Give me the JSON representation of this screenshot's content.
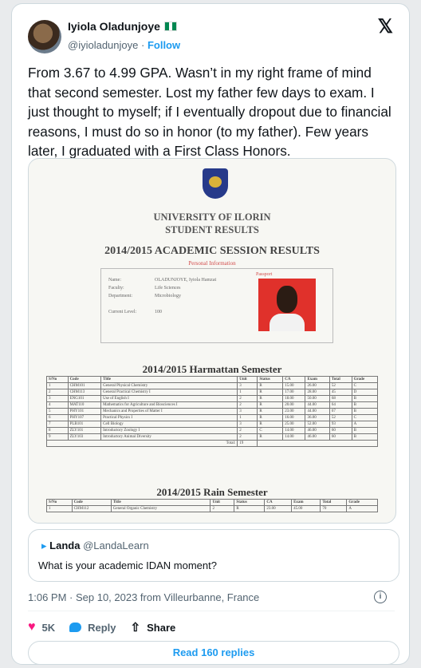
{
  "tweet": {
    "author_name": "Iyiola Oladunjoye",
    "handle": "@iyioladunjoye",
    "separator": "·",
    "follow_label": "Follow",
    "text": "From 3.67 to 4.99 GPA. Wasn’t in my right frame of mind that second semester. Lost my father few days to exam. I just thought to myself; if I eventually dropout due to financial reasons, I must do so in honor (to my father). Few years later, I graduated with a First Class Honors.",
    "flag_colors": [
      "#008751",
      "#ffffff",
      "#008751"
    ],
    "x_logo": "𝕏"
  },
  "media": {
    "university": "UNIVERSITY OF ILORIN",
    "subtitle": "STUDENT RESULTS",
    "session_title": "2014/2015 ACADEMIC SESSION RESULTS",
    "personal_info": "Personal Information",
    "passport": "Passport",
    "fields": [
      "Name:",
      "Faculty:",
      "Department:",
      "Current Level:"
    ],
    "field_values": [
      "OLADUNJOYE, Iyiola Hamzat",
      "Life Sciences",
      "Microbiology",
      "100"
    ],
    "semester1_title": "2014/2015 Harmattan Semester",
    "semester2_title": "2014/2015 Rain Semester",
    "table_headers": [
      "S/No",
      "Code",
      "Title",
      "Unit",
      "Status",
      "CA",
      "Exam",
      "Total",
      "Grade"
    ],
    "rows1": [
      [
        "1",
        "CHM101",
        "General Physical Chemistry",
        "3",
        "R",
        "15.00",
        "26.00",
        "52",
        "C"
      ],
      [
        "2",
        "CHM113",
        "General Practical Chemistry I",
        "1",
        "R",
        "17.00",
        "28.00",
        "45",
        "D"
      ],
      [
        "3",
        "ENG101",
        "Use of English I",
        "2",
        "R",
        "18.00",
        "50.00",
        "68",
        "B"
      ],
      [
        "4",
        "MAT110",
        "Mathematics for Agriculture and Biosciences I",
        "2",
        "R",
        "20.00",
        "44.00",
        "64",
        "B"
      ],
      [
        "5",
        "PHY101",
        "Mechanics and Properties of Matter I",
        "3",
        "R",
        "23.00",
        "44.00",
        "67",
        "B"
      ],
      [
        "6",
        "PHY107",
        "Practical Physics I",
        "1",
        "R",
        "16.00",
        "36.00",
        "52",
        "C"
      ],
      [
        "7",
        "PLB101",
        "Cell Biology",
        "3",
        "R",
        "25.00",
        "52.00",
        "93",
        "A"
      ],
      [
        "8",
        "ZLY101",
        "Introductory Zoology I",
        "2",
        "C",
        "14.00",
        "46.00",
        "60",
        "B"
      ],
      [
        "9",
        "ZLY103",
        "Introductory Animal Diversity",
        "2",
        "R",
        "14.00",
        "46.00",
        "60",
        "B"
      ]
    ],
    "total_label": "Total:",
    "total_units": "19",
    "rows2": [
      [
        "1",
        "CHM112",
        "General Organic Chemistry",
        "2",
        "R",
        "23.00",
        "45.00",
        "70",
        "A"
      ]
    ]
  },
  "quote": {
    "name": "Landa",
    "handle": "@LandaLearn",
    "text": "What is your academic IDAN moment?"
  },
  "meta": {
    "timestamp": "1:06 PM · Sep 10, 2023 from Villeurbanne, France",
    "info_glyph": "i"
  },
  "actions": {
    "likes": "5K",
    "reply_label": "Reply",
    "share_label": "Share",
    "read_replies": "Read 160 replies"
  },
  "colors": {
    "accent": "#1d9bf0",
    "like": "#f91880",
    "text": "#0f1419",
    "muted": "#536471"
  }
}
